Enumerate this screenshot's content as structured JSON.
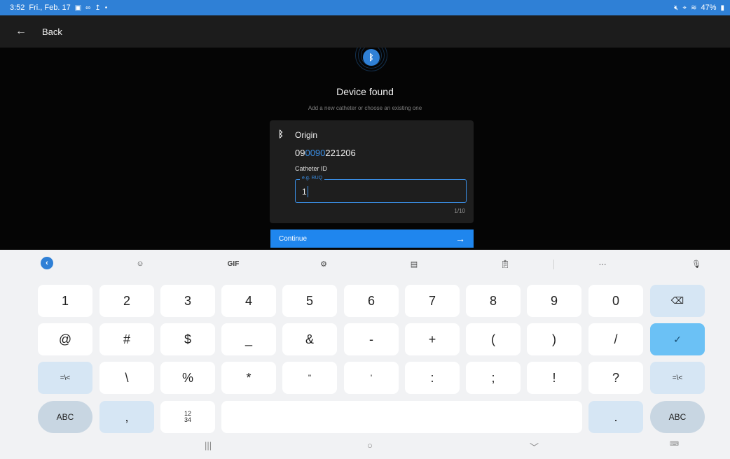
{
  "status_bar": {
    "time": "3:52",
    "date": "Fri., Feb. 17",
    "notif_icons": [
      "image-icon",
      "infinity-icon",
      "upload-icon",
      "dot"
    ],
    "battery": "47%"
  },
  "app_bar": {
    "back_label": "Back"
  },
  "main": {
    "title": "Device found",
    "subtitle": "Add a new catheter or choose an existing one"
  },
  "device_card": {
    "name": "Origin",
    "serial_prefix": "09",
    "serial_highlight": "0090",
    "serial_suffix": "221206",
    "catheter_label": "Catheter ID",
    "field_placeholder": "e.g. RUQ",
    "field_value": "1",
    "char_counter": "1/10"
  },
  "continue_button": {
    "label": "Continue"
  },
  "keyboard": {
    "toolbar": [
      "collapse",
      "sticker",
      "GIF",
      "settings",
      "keyboard-layout",
      "clipboard",
      "more",
      "mic"
    ],
    "gif_label": "GIF",
    "row1": [
      "1",
      "2",
      "3",
      "4",
      "5",
      "6",
      "7",
      "8",
      "9",
      "0"
    ],
    "row2": [
      "@",
      "#",
      "$",
      "_",
      "&",
      "-",
      "+",
      "(",
      ")",
      "/"
    ],
    "row3": [
      "\\",
      "%",
      "*",
      "\"",
      "'",
      ":",
      ";",
      "!",
      "?"
    ],
    "sym_toggle": "=\\<",
    "abc_label": "ABC",
    "comma": ",",
    "period": ".",
    "num_toggle_top": "12",
    "num_toggle_bottom": "34"
  },
  "colors": {
    "accent": "#2f80d6",
    "button": "#1f86ee",
    "ok_key": "#6bc1f5"
  }
}
